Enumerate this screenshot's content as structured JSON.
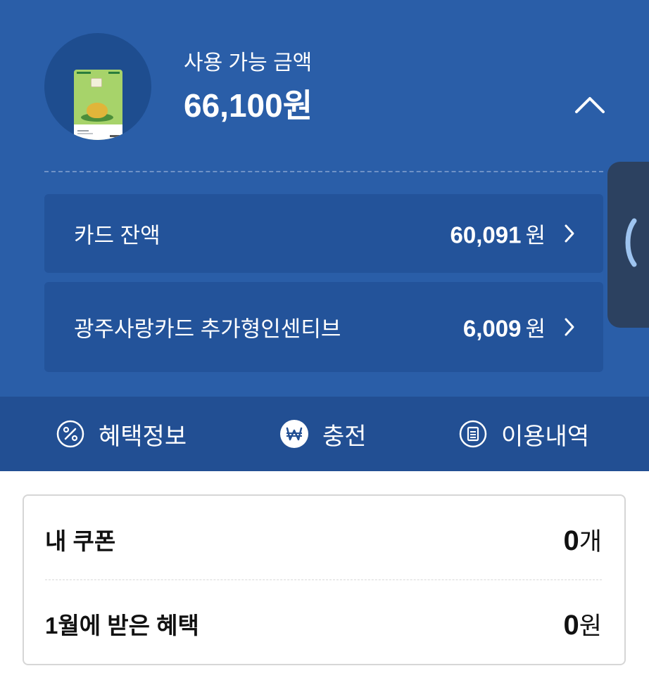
{
  "balance": {
    "label": "사용 가능 금액",
    "amount": "66,100원"
  },
  "rows": [
    {
      "label": "카드 잔액",
      "value": "60,091",
      "unit": "원"
    },
    {
      "label": "광주사랑카드 추가형인센티브",
      "value": "6,009",
      "unit": "원"
    }
  ],
  "actions": [
    {
      "label": "혜택정보",
      "icon": "percent-icon"
    },
    {
      "label": "충전",
      "icon": "won-icon"
    },
    {
      "label": "이용내역",
      "icon": "receipt-icon"
    }
  ],
  "summary": {
    "coupons_label": "내 쿠폰",
    "coupons_value": "0",
    "coupons_unit": "개",
    "benefit_label": "1월에 받은 혜택",
    "benefit_value": "0",
    "benefit_unit": "원"
  },
  "colors": {
    "header_bg": "#2a5ea8",
    "row_bg": "#23539a",
    "action_bar_bg": "#224f93",
    "side_handle_bg": "#2c4160",
    "side_handle_icon": "#9ec4f0"
  }
}
